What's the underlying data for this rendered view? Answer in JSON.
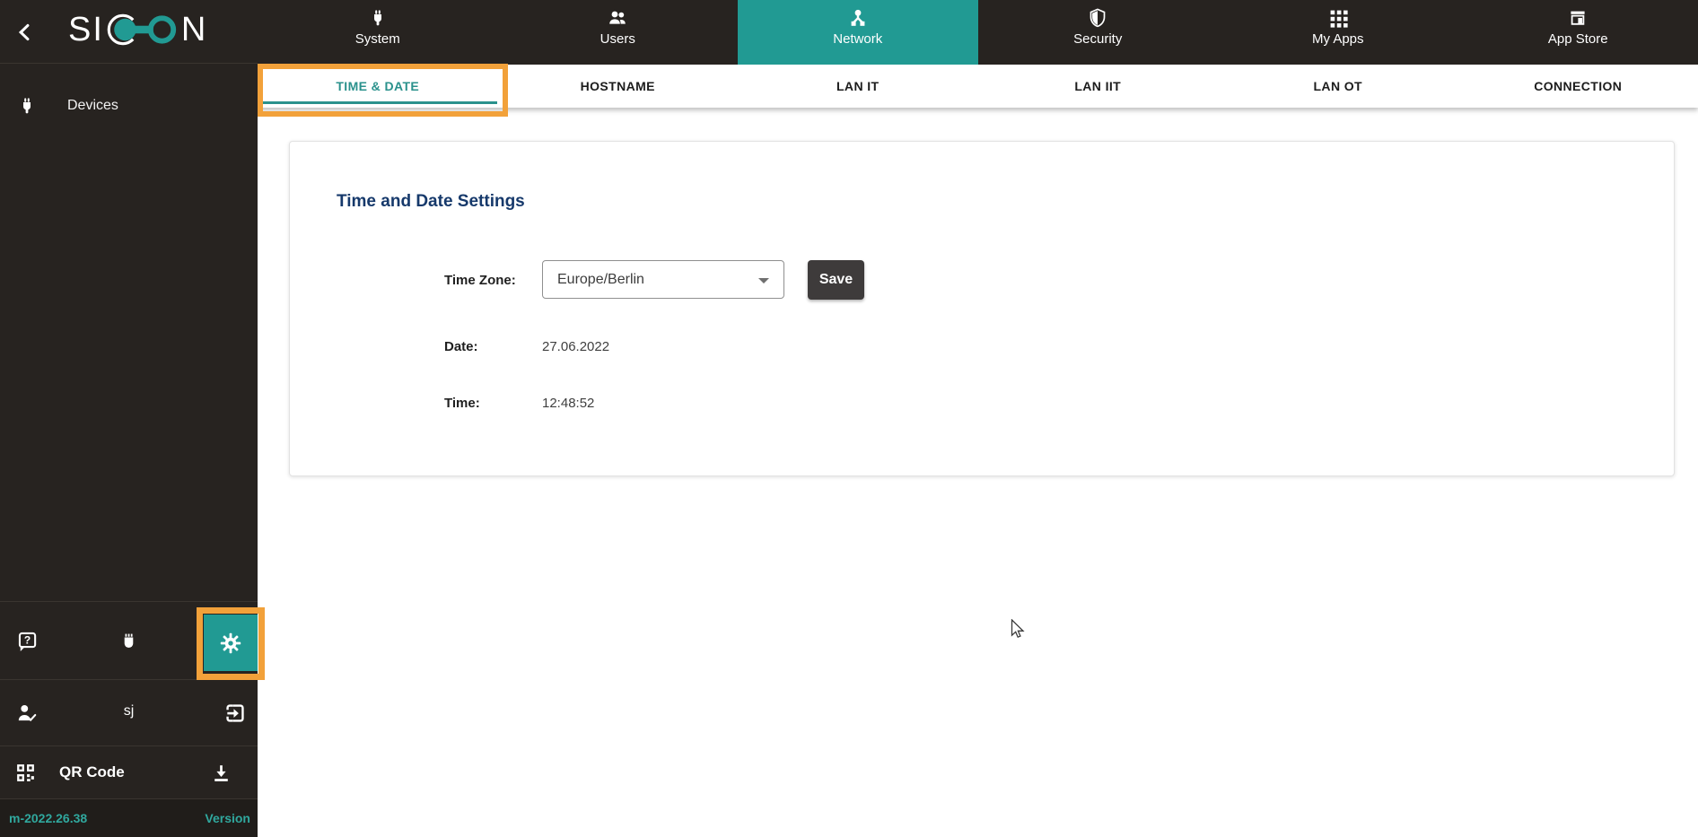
{
  "sidebar": {
    "logo_prefix": "SI",
    "logo_suffix": "N",
    "items": [
      {
        "label": "Devices",
        "icon": "plug-icon"
      }
    ],
    "username": "sj",
    "qr_label": "QR Code",
    "version_value": "m-2022.26.38",
    "version_label": "Version"
  },
  "topnav": {
    "tabs": [
      {
        "label": "System",
        "icon": "plug-icon",
        "active": false
      },
      {
        "label": "Users",
        "icon": "users-icon",
        "active": false
      },
      {
        "label": "Network",
        "icon": "network-icon",
        "active": true
      },
      {
        "label": "Security",
        "icon": "shield-icon",
        "active": false
      },
      {
        "label": "My Apps",
        "icon": "apps-grid-icon",
        "active": false
      },
      {
        "label": "App Store",
        "icon": "store-icon",
        "active": false
      }
    ]
  },
  "subnav": {
    "tabs": [
      {
        "label": "TIME & DATE",
        "active": true
      },
      {
        "label": "HOSTNAME",
        "active": false
      },
      {
        "label": "LAN IT",
        "active": false
      },
      {
        "label": "LAN IIT",
        "active": false
      },
      {
        "label": "LAN OT",
        "active": false
      },
      {
        "label": "CONNECTION",
        "active": false
      }
    ]
  },
  "panel": {
    "heading": "Time and Date Settings",
    "timezone_label": "Time Zone:",
    "timezone_value": "Europe/Berlin",
    "save_label": "Save",
    "date_label": "Date:",
    "date_value": "27.06.2022",
    "time_label": "Time:",
    "time_value": "12:48:52"
  },
  "colors": {
    "accent_teal": "#219a93",
    "subtab_teal": "#2a918c",
    "highlight_orange": "#f2a13a",
    "sidebar_dark": "#272320",
    "heading_navy": "#16396b",
    "button_dark": "#3e3b3b",
    "version_teal": "#30a89e"
  }
}
